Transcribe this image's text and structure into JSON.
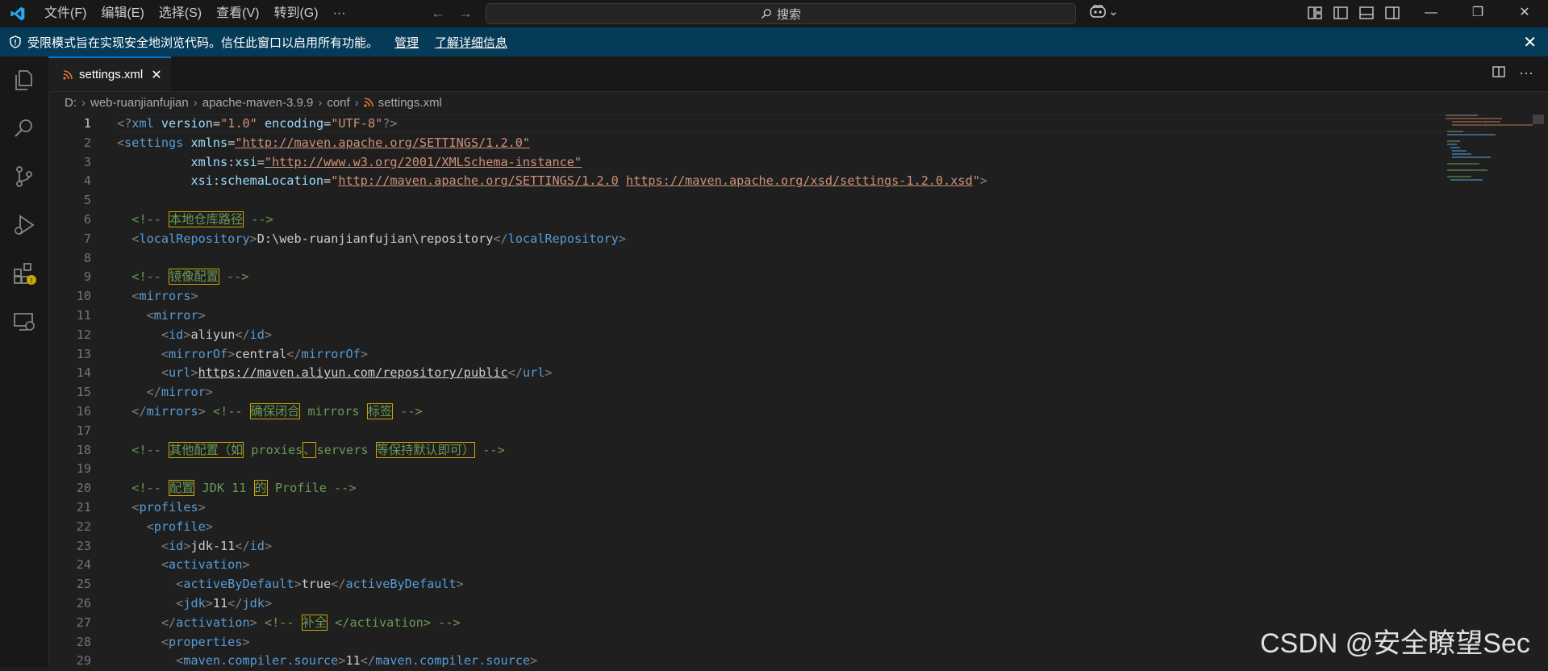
{
  "menu": [
    "文件(F)",
    "编辑(E)",
    "选择(S)",
    "查看(V)",
    "转到(G)",
    "···"
  ],
  "search": {
    "label": "搜索"
  },
  "window_controls": {
    "minimize": "—",
    "restore": "❐",
    "close": "✕"
  },
  "banner": {
    "message": "受限模式旨在实现安全地浏览代码。信任此窗口以启用所有功能。",
    "manage": "管理",
    "learn_more": "了解详细信息"
  },
  "tab": {
    "title": "settings.xml",
    "close": "✕"
  },
  "breadcrumb": [
    "D:",
    "web-ruanjianfujian",
    "apache-maven-3.9.9",
    "conf",
    "settings.xml"
  ],
  "editor": {
    "line_numbers": [
      "1",
      "2",
      "3",
      "4",
      "5",
      "6",
      "7",
      "8",
      "9",
      "10",
      "11",
      "12",
      "13",
      "14",
      "15",
      "16",
      "17",
      "18",
      "19",
      "20",
      "21",
      "22",
      "23",
      "24",
      "25",
      "26",
      "27",
      "28",
      "29"
    ],
    "xml_decl": {
      "version": "\"1.0\"",
      "encoding": "\"UTF-8\""
    },
    "settings_ns": {
      "xmlns": "\"http://maven.apache.org/SETTINGS/1.2.0\"",
      "xsi": "\"http://www.w3.org/2001/XMLSchema-instance\"",
      "schema_a": "http://maven.apache.org/SETTINGS/1.2.0",
      "schema_b": "https://maven.apache.org/xsd/settings-1.2.0.xsd"
    },
    "comment_repo": "本地仓库路径",
    "local_repository": "D:\\web-ruanjianfujian\\repository",
    "comment_mirror": "镜像配置",
    "mirror_id": "aliyun",
    "mirror_of": "central",
    "mirror_url": "https://maven.aliyun.com/repository/public",
    "comment_close_a": "确保闭合",
    "comment_close_b": " mirrors ",
    "comment_close_c": "标签",
    "comment_other_a": "其他配置（如",
    "comment_other_b": " proxies",
    "comment_other_c": "、",
    "comment_other_d": "servers ",
    "comment_other_e": "等保持默认即可）",
    "comment_jdk_a": "配置",
    "comment_jdk_b": " JDK 11 ",
    "comment_jdk_c": "的",
    "comment_jdk_d": " Profile ",
    "profile_id": "jdk-11",
    "active_by_default": "true",
    "jdk": "11",
    "comment_fix": "补全",
    "compiler_source": "11"
  },
  "watermark": "CSDN @安全瞭望Sec",
  "colors": {
    "accent": "#0078d4",
    "banner": "#063b58",
    "tag": "#569cd6",
    "string": "#ce9178",
    "comment": "#6a9955",
    "attribute": "#9cdcfe"
  }
}
